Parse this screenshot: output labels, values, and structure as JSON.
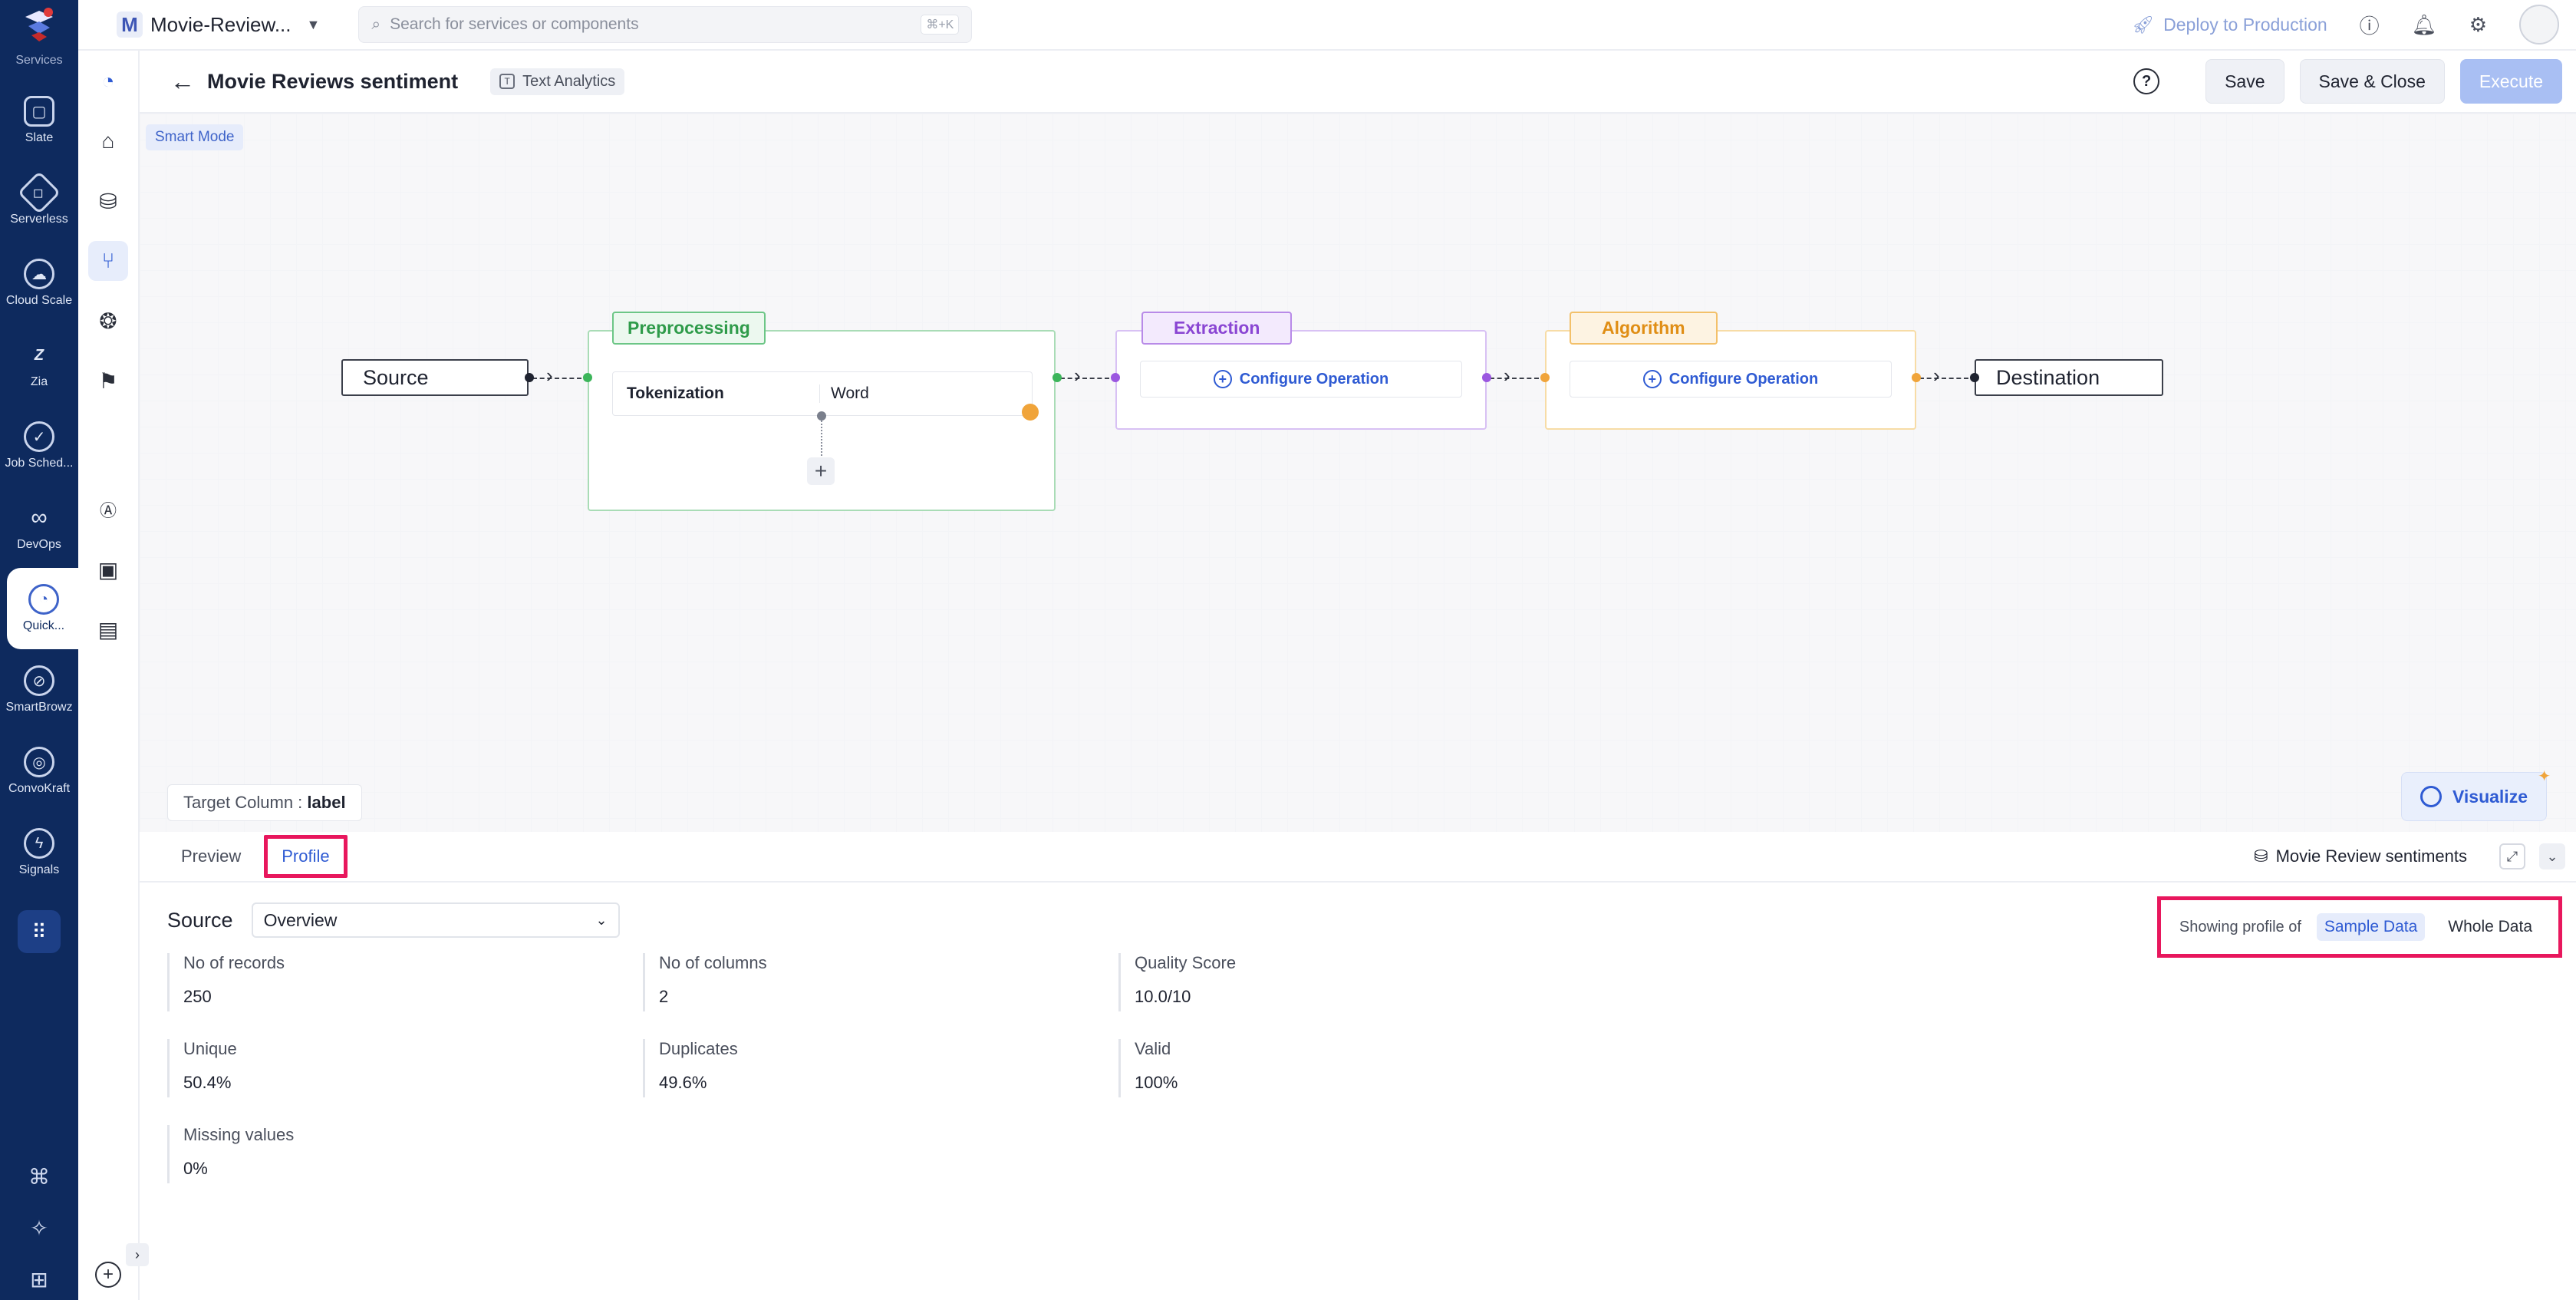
{
  "rail": {
    "brand_label": "Services",
    "items": [
      {
        "label": "Slate",
        "icon": "slate-icon"
      },
      {
        "label": "Serverless",
        "icon": "code-icon"
      },
      {
        "label": "Cloud Scale",
        "icon": "cloud-icon"
      },
      {
        "label": "Zia",
        "icon": "zia-icon"
      },
      {
        "label": "Job Sched...",
        "icon": "check-circle-icon"
      },
      {
        "label": "DevOps",
        "icon": "infinity-icon"
      },
      {
        "label": "Quick...",
        "icon": "quickml-icon"
      },
      {
        "label": "SmartBrowz",
        "icon": "browser-icon"
      },
      {
        "label": "ConvoKraft",
        "icon": "chat-icon"
      },
      {
        "label": "Signals",
        "icon": "signals-icon"
      }
    ]
  },
  "topbar": {
    "project_initial": "M",
    "project_name": "Movie-Review...",
    "search_placeholder": "Search for services or components",
    "search_shortcut": "⌘+K",
    "deploy_label": "Deploy to Production"
  },
  "header": {
    "title": "Movie Reviews sentiment",
    "tag": "Text Analytics",
    "save": "Save",
    "save_close": "Save & Close",
    "execute": "Execute"
  },
  "canvas": {
    "smart_mode": "Smart Mode",
    "source": "Source",
    "destination": "Destination",
    "preprocessing": {
      "label": "Preprocessing",
      "op_name": "Tokenization",
      "op_value": "Word"
    },
    "extraction": {
      "label": "Extraction",
      "configure": "Configure Operation"
    },
    "algorithm": {
      "label": "Algorithm",
      "configure": "Configure Operation"
    },
    "target_column_label": "Target Column :",
    "target_column_value": "label",
    "visualize": "Visualize",
    "colors": {
      "preprocessing": "#3cb55a",
      "extraction": "#9b57e0",
      "algorithm": "#f0a43a"
    }
  },
  "panel": {
    "tabs": [
      "Preview",
      "Profile"
    ],
    "active_tab": "Profile",
    "dataset_name": "Movie Review sentiments",
    "source_title": "Source",
    "view_select": "Overview",
    "profile_of_label": "Showing profile of",
    "profile_options": [
      "Sample Data",
      "Whole Data"
    ],
    "stats": [
      {
        "label": "No of records",
        "value": "250"
      },
      {
        "label": "No of columns",
        "value": "2"
      },
      {
        "label": "Quality Score",
        "value": "10.0/10"
      },
      {
        "label": "Unique",
        "value": "50.4%"
      },
      {
        "label": "Duplicates",
        "value": "49.6%"
      },
      {
        "label": "Valid",
        "value": "100%"
      },
      {
        "label": "Missing values",
        "value": "0%"
      }
    ]
  }
}
